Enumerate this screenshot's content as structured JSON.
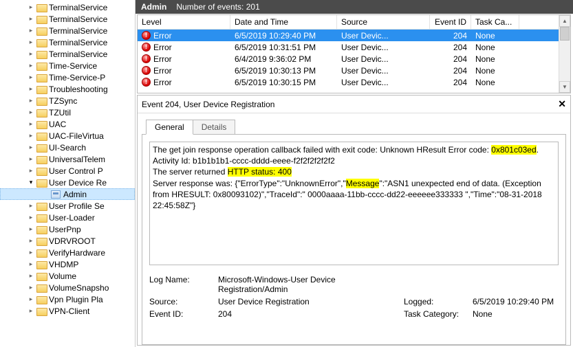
{
  "header": {
    "title": "Admin",
    "count_label": "Number of events: 201"
  },
  "tree": {
    "items": [
      {
        "label": "TerminalService",
        "child": false,
        "open": false,
        "icon": "folder"
      },
      {
        "label": "TerminalService",
        "child": false,
        "open": false,
        "icon": "folder"
      },
      {
        "label": "TerminalService",
        "child": false,
        "open": false,
        "icon": "folder"
      },
      {
        "label": "TerminalService",
        "child": false,
        "open": false,
        "icon": "folder"
      },
      {
        "label": "TerminalService",
        "child": false,
        "open": false,
        "icon": "folder"
      },
      {
        "label": "Time-Service",
        "child": false,
        "open": false,
        "icon": "folder"
      },
      {
        "label": "Time-Service-P",
        "child": false,
        "open": false,
        "icon": "folder"
      },
      {
        "label": "Troubleshooting",
        "child": false,
        "open": false,
        "icon": "folder"
      },
      {
        "label": "TZSync",
        "child": false,
        "open": false,
        "icon": "folder"
      },
      {
        "label": "TZUtil",
        "child": false,
        "open": false,
        "icon": "folder"
      },
      {
        "label": "UAC",
        "child": false,
        "open": false,
        "icon": "folder"
      },
      {
        "label": "UAC-FileVirtua",
        "child": false,
        "open": false,
        "icon": "folder"
      },
      {
        "label": "UI-Search",
        "child": false,
        "open": false,
        "icon": "folder"
      },
      {
        "label": "UniversalTelem",
        "child": false,
        "open": false,
        "icon": "folder"
      },
      {
        "label": "User Control P",
        "child": false,
        "open": false,
        "icon": "folder"
      },
      {
        "label": "User Device Re",
        "child": false,
        "open": true,
        "icon": "folder"
      },
      {
        "label": "Admin",
        "child": true,
        "open": null,
        "icon": "admin",
        "selected": true
      },
      {
        "label": "User Profile Se",
        "child": false,
        "open": false,
        "icon": "folder"
      },
      {
        "label": "User-Loader",
        "child": false,
        "open": false,
        "icon": "folder"
      },
      {
        "label": "UserPnp",
        "child": false,
        "open": false,
        "icon": "folder"
      },
      {
        "label": "VDRVROOT",
        "child": false,
        "open": false,
        "icon": "folder"
      },
      {
        "label": "VerifyHardware",
        "child": false,
        "open": false,
        "icon": "folder"
      },
      {
        "label": "VHDMP",
        "child": false,
        "open": false,
        "icon": "folder"
      },
      {
        "label": "Volume",
        "child": false,
        "open": false,
        "icon": "folder"
      },
      {
        "label": "VolumeSnapsho",
        "child": false,
        "open": false,
        "icon": "folder"
      },
      {
        "label": "Vpn Plugin Pla",
        "child": false,
        "open": false,
        "icon": "folder"
      },
      {
        "label": "VPN-Client",
        "child": false,
        "open": false,
        "icon": "folder"
      }
    ]
  },
  "columns": {
    "level": "Level",
    "date": "Date and Time",
    "source": "Source",
    "id": "Event ID",
    "cat": "Task Ca..."
  },
  "events": [
    {
      "level": "Error",
      "date": "6/5/2019 10:29:40 PM",
      "source": "User Devic...",
      "id": "204",
      "cat": "None",
      "selected": true
    },
    {
      "level": "Error",
      "date": "6/5/2019 10:31:51 PM",
      "source": "User Devic...",
      "id": "204",
      "cat": "None"
    },
    {
      "level": "Error",
      "date": "6/4/2019 9:36:02 PM",
      "source": "User Devic...",
      "id": "204",
      "cat": "None"
    },
    {
      "level": "Error",
      "date": "6/5/2019 10:30:13 PM",
      "source": "User Devic...",
      "id": "204",
      "cat": "None"
    },
    {
      "level": "Error",
      "date": "6/5/2019 10:30:15 PM",
      "source": "User Devic...",
      "id": "204",
      "cat": "None"
    }
  ],
  "detail": {
    "title": "Event 204, User Device Registration",
    "tabs": {
      "general": "General",
      "details": "Details"
    },
    "message": {
      "line1a": "The get join response operation callback failed with exit code: Unknown HResult Error code: ",
      "line1b_hl": "0x801c03ed",
      "line1c": ".",
      "line2": "Activity Id: b1b1b1b1-cccc-dddd-eeee-f2f2f2f2f2f2",
      "line3a": "The server returned ",
      "line3b_hl": "HTTP status: 400",
      "line4a": "Server response was: {\"ErrorType\":\"UnknownError\",\"",
      "line4b_hl": "Message",
      "line4c": "\":\"ASN1 unexpected end of data. (Exception from HRESULT: 0x80093102)\",\"TraceId\":\" 0000aaaa-11bb-cccc-dd22-eeeeee333333 \",\"Time\":\"08-31-2018 22:45:58Z\"}"
    },
    "meta": {
      "logname_l": "Log Name:",
      "logname_v": "Microsoft-Windows-User Device Registration/Admin",
      "source_l": "Source:",
      "source_v": "User Device Registration",
      "logged_l": "Logged:",
      "logged_v": "6/5/2019 10:29:40 PM",
      "eventid_l": "Event ID:",
      "eventid_v": "204",
      "taskcat_l": "Task Category:",
      "taskcat_v": "None"
    }
  }
}
